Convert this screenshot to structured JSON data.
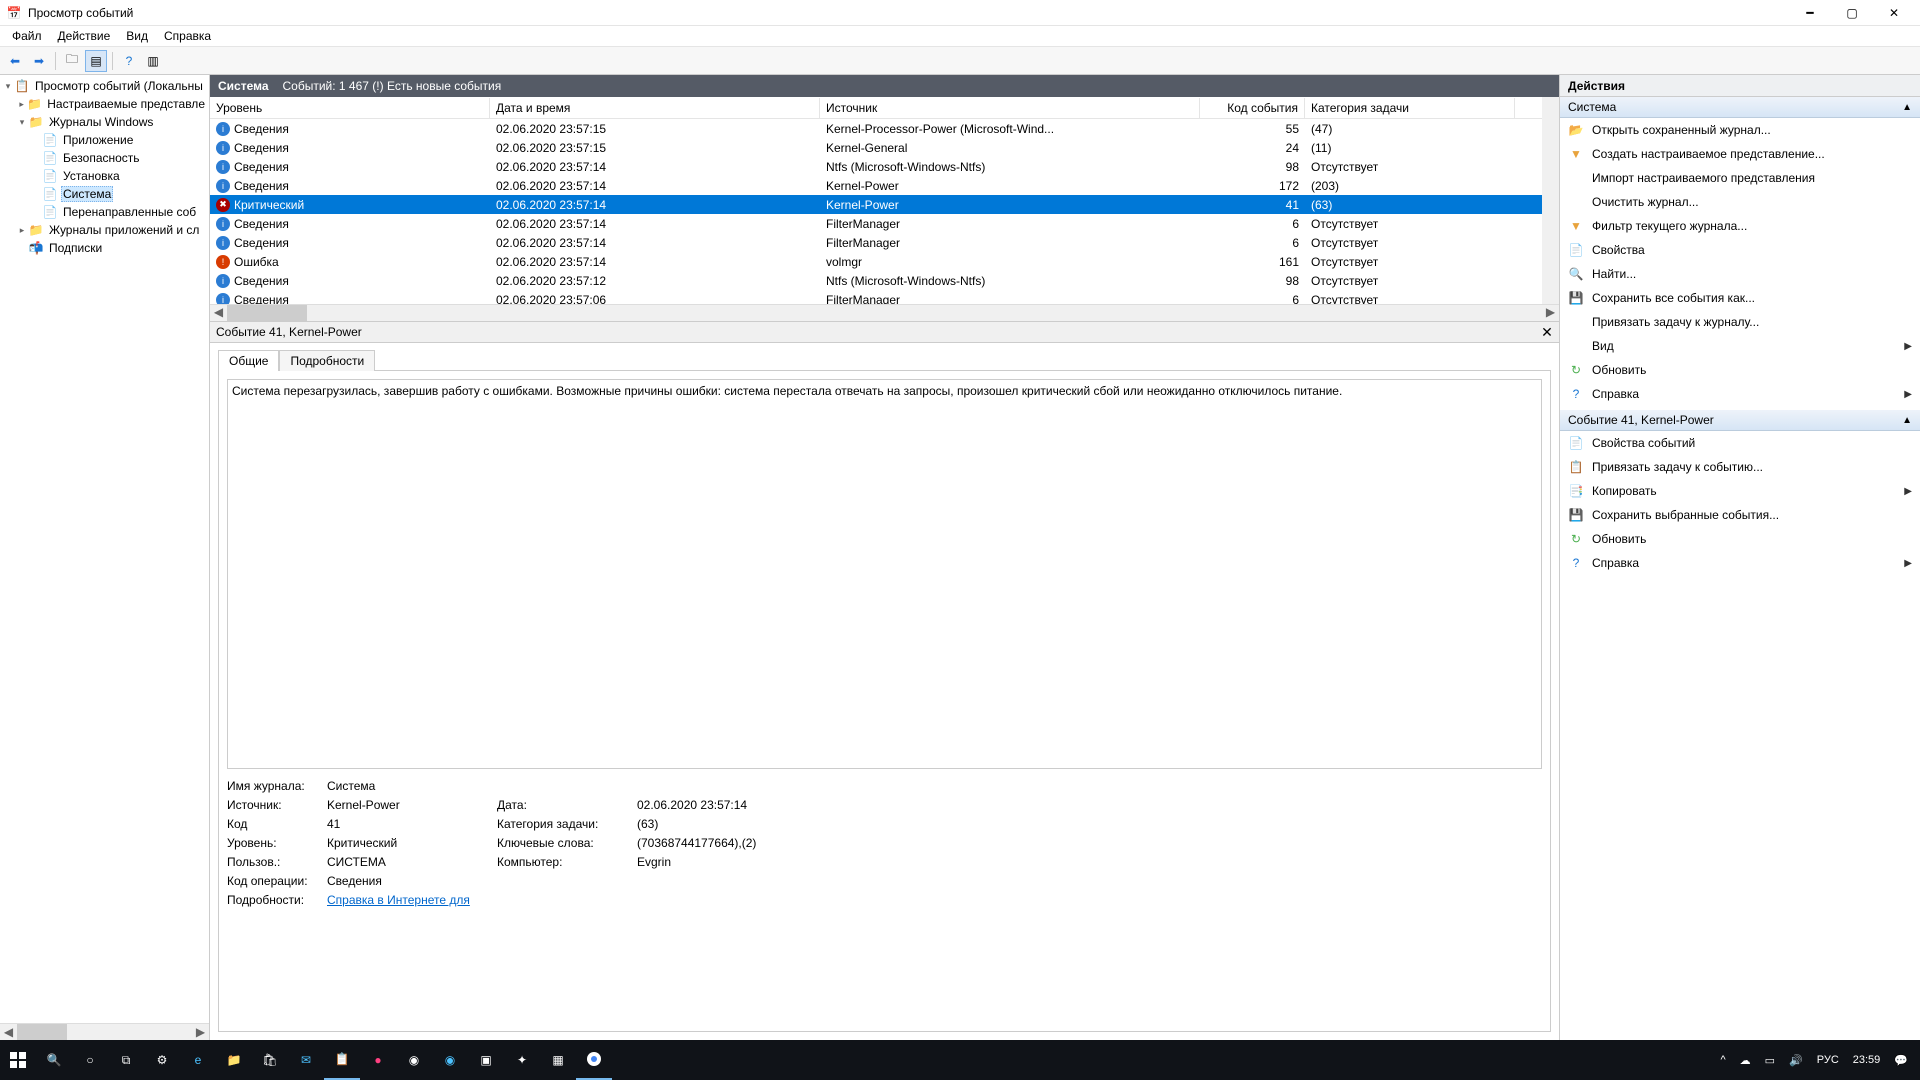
{
  "window": {
    "title": "Просмотр событий"
  },
  "menu": [
    "Файл",
    "Действие",
    "Вид",
    "Справка"
  ],
  "center": {
    "title": "Система",
    "subtitle": "Событий: 1 467 (!) Есть новые события",
    "columns": [
      "Уровень",
      "Дата и время",
      "Источник",
      "Код события",
      "Категория задачи"
    ],
    "events": [
      {
        "level": "info",
        "level_text": "Сведения",
        "date": "02.06.2020 23:57:15",
        "source": "Kernel-Processor-Power (Microsoft-Wind...",
        "id": "55",
        "task": "(47)"
      },
      {
        "level": "info",
        "level_text": "Сведения",
        "date": "02.06.2020 23:57:15",
        "source": "Kernel-General",
        "id": "24",
        "task": "(11)"
      },
      {
        "level": "info",
        "level_text": "Сведения",
        "date": "02.06.2020 23:57:14",
        "source": "Ntfs (Microsoft-Windows-Ntfs)",
        "id": "98",
        "task": "Отсутствует"
      },
      {
        "level": "info",
        "level_text": "Сведения",
        "date": "02.06.2020 23:57:14",
        "source": "Kernel-Power",
        "id": "172",
        "task": "(203)"
      },
      {
        "level": "critical",
        "level_text": "Критический",
        "date": "02.06.2020 23:57:14",
        "source": "Kernel-Power",
        "id": "41",
        "task": "(63)",
        "selected": true
      },
      {
        "level": "info",
        "level_text": "Сведения",
        "date": "02.06.2020 23:57:14",
        "source": "FilterManager",
        "id": "6",
        "task": "Отсутствует"
      },
      {
        "level": "info",
        "level_text": "Сведения",
        "date": "02.06.2020 23:57:14",
        "source": "FilterManager",
        "id": "6",
        "task": "Отсутствует"
      },
      {
        "level": "error",
        "level_text": "Ошибка",
        "date": "02.06.2020 23:57:14",
        "source": "volmgr",
        "id": "161",
        "task": "Отсутствует"
      },
      {
        "level": "info",
        "level_text": "Сведения",
        "date": "02.06.2020 23:57:12",
        "source": "Ntfs (Microsoft-Windows-Ntfs)",
        "id": "98",
        "task": "Отсутствует"
      },
      {
        "level": "info",
        "level_text": "Сведения",
        "date": "02.06.2020 23:57:06",
        "source": "FilterManager",
        "id": "6",
        "task": "Отсутствует"
      }
    ]
  },
  "detail": {
    "header": "Событие 41, Kernel-Power",
    "tabs": [
      "Общие",
      "Подробности"
    ],
    "description": "Система перезагрузилась, завершив работу с ошибками. Возможные причины ошибки: система перестала отвечать на запросы, произошел критический сбой или неожиданно отключилось питание.",
    "labels": {
      "log": "Имя журнала:",
      "log_v": "Система",
      "src": "Источник:",
      "src_v": "Kernel-Power",
      "date": "Дата:",
      "date_v": "02.06.2020 23:57:14",
      "code": "Код",
      "code_v": "41",
      "cat": "Категория задачи:",
      "cat_v": "(63)",
      "lvl": "Уровень:",
      "lvl_v": "Критический",
      "kw": "Ключевые слова:",
      "kw_v": "(70368744177664),(2)",
      "user": "Пользов.:",
      "user_v": "СИСТЕМА",
      "comp": "Компьютер:",
      "comp_v": "Evgrin",
      "op": "Код операции:",
      "op_v": "Сведения",
      "more": "Подробности:",
      "more_v": "Справка в Интернете для "
    }
  },
  "tree": {
    "root": "Просмотр событий (Локальны",
    "custom": "Настраиваемые представле",
    "winlogs": "Журналы Windows",
    "app": "Приложение",
    "sec": "Безопасность",
    "setup": "Установка",
    "sys": "Система",
    "fwd": "Перенаправленные соб",
    "appserv": "Журналы приложений и сл",
    "subs": "Подписки"
  },
  "actions": {
    "title": "Действия",
    "group1": "Система",
    "items1": [
      {
        "icon": "📂",
        "t": "Открыть сохраненный журнал..."
      },
      {
        "icon": "▼",
        "t": "Создать настраиваемое представление...",
        "iconcolor": "#e8a33d"
      },
      {
        "icon": " ",
        "t": "Импорт настраиваемого представления"
      },
      {
        "icon": " ",
        "t": "Очистить журнал..."
      },
      {
        "icon": "▼",
        "t": "Фильтр текущего журнала...",
        "iconcolor": "#e8a33d"
      },
      {
        "icon": "📄",
        "t": "Свойства"
      },
      {
        "icon": "🔍",
        "t": "Найти..."
      },
      {
        "icon": "💾",
        "t": "Сохранить все события как..."
      },
      {
        "icon": " ",
        "t": "Привязать задачу к журналу..."
      },
      {
        "icon": " ",
        "t": "Вид",
        "arrow": true
      },
      {
        "icon": "↻",
        "t": "Обновить",
        "iconcolor": "#4caf50"
      },
      {
        "icon": "?",
        "t": "Справка",
        "iconcolor": "#1976d2",
        "arrow": true
      }
    ],
    "group2": "Событие 41, Kernel-Power",
    "items2": [
      {
        "icon": "📄",
        "t": "Свойства событий"
      },
      {
        "icon": "📋",
        "t": "Привязать задачу к событию..."
      },
      {
        "icon": "📑",
        "t": "Копировать",
        "arrow": true
      },
      {
        "icon": "💾",
        "t": "Сохранить выбранные события..."
      },
      {
        "icon": "↻",
        "t": "Обновить",
        "iconcolor": "#4caf50"
      },
      {
        "icon": "?",
        "t": "Справка",
        "iconcolor": "#1976d2",
        "arrow": true
      }
    ]
  },
  "taskbar": {
    "lang": "РУС",
    "time": "23:59"
  }
}
